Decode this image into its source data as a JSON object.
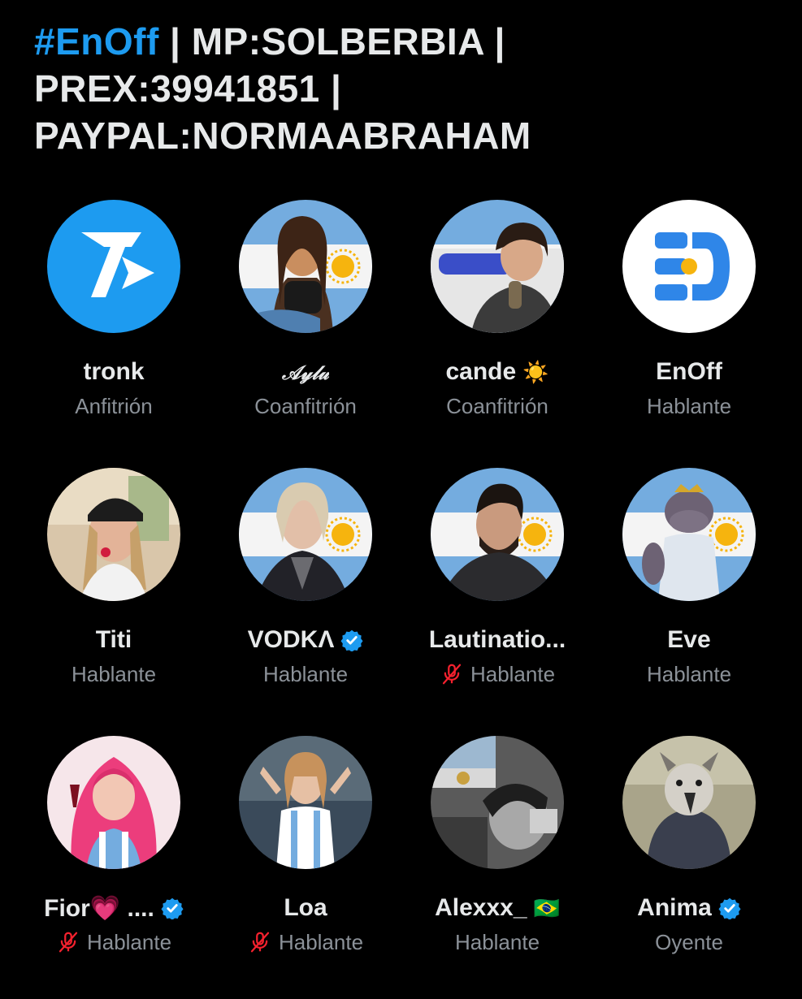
{
  "header": {
    "hashtag": "#EnOff",
    "rest": " | MP:SOLBERBIA | PREX:39941851 | PAYPAL:NORMAABRAHAM"
  },
  "colors": {
    "background": "#000000",
    "accent": "#1d9bf0",
    "muted": "#8b9198",
    "mute_icon": "#f4212e"
  },
  "participants": [
    {
      "name": "tronk",
      "role": "Anfitrión",
      "verified": false,
      "muted": false,
      "emoji": "",
      "avatar": "tronk-logo"
    },
    {
      "name": "𝒜𝓎𝓁𝓊",
      "role": "Coanfitrión",
      "verified": false,
      "muted": false,
      "emoji": "",
      "avatar": "cartoon-girl-flag"
    },
    {
      "name": "cande",
      "role": "Coanfitrión",
      "verified": false,
      "muted": false,
      "emoji": "☀️",
      "avatar": "woman-drinking-mate"
    },
    {
      "name": "EnOff",
      "role": "Hablante",
      "verified": false,
      "muted": false,
      "emoji": "",
      "avatar": "enoff-logo"
    },
    {
      "name": "Titi",
      "role": "Hablante",
      "verified": false,
      "muted": false,
      "emoji": "",
      "avatar": "girl-cap-photo"
    },
    {
      "name": "VODKΛ",
      "role": "Hablante",
      "verified": true,
      "muted": false,
      "emoji": "",
      "avatar": "blonde-queen-flag"
    },
    {
      "name": "Lautinatio...",
      "role": "Hablante",
      "verified": false,
      "muted": true,
      "emoji": "",
      "avatar": "bearded-man-flag"
    },
    {
      "name": "Eve",
      "role": "Hablante",
      "verified": false,
      "muted": false,
      "emoji": "",
      "avatar": "hippo-dress-flag"
    },
    {
      "name": "Fior💗 ....",
      "role": "Hablante",
      "verified": true,
      "muted": true,
      "emoji": "",
      "avatar": "pink-hair-girl"
    },
    {
      "name": "Loa",
      "role": "Hablante",
      "verified": false,
      "muted": true,
      "emoji": "",
      "avatar": "jersey-10-girl"
    },
    {
      "name": "Alexxx_",
      "role": "Hablante",
      "verified": false,
      "muted": false,
      "emoji": "🇧🇷",
      "avatar": "bw-flag-collage"
    },
    {
      "name": "Anima",
      "role": "Oyente",
      "verified": true,
      "muted": false,
      "emoji": "",
      "avatar": "harpy-eagle"
    }
  ]
}
